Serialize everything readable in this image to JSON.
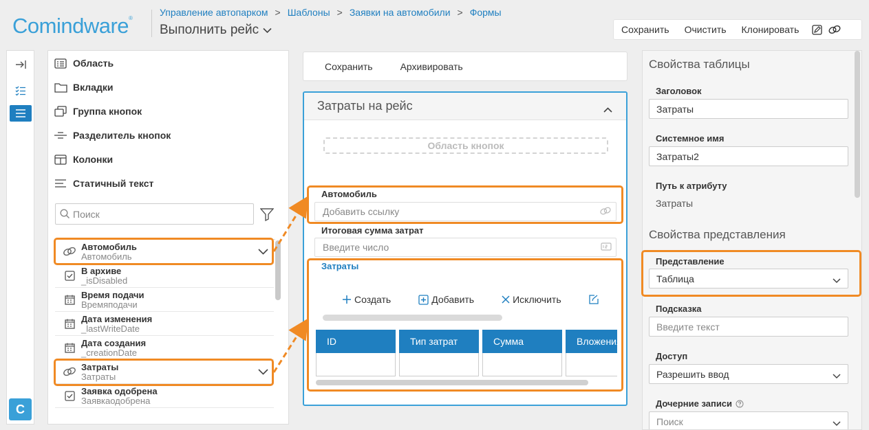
{
  "app": {
    "logo": "Comindware",
    "logo_mark": "®"
  },
  "header": {
    "breadcrumbs": [
      "Управление автопарком",
      "Шаблоны",
      "Заявки на автомобили",
      "Формы"
    ],
    "breadcrumb_sep": ">",
    "page_title": "Выполнить рейс"
  },
  "topbar": {
    "save": "Сохранить",
    "clear": "Очистить",
    "clone": "Клонировать"
  },
  "rail": {
    "c_label": "C"
  },
  "left": {
    "tools": [
      "Область",
      "Вкладки",
      "Группа кнопок",
      "Разделитель кнопок",
      "Колонки",
      "Статичный текст"
    ],
    "search_placeholder": "Поиск",
    "attributes": [
      {
        "name": "Автомобиль",
        "sys": "Автомобиль",
        "icon": "link-icon",
        "expand": true
      },
      {
        "name": "В архиве",
        "sys": "_isDisabled",
        "icon": "checkbox-icon",
        "expand": false
      },
      {
        "name": "Время подачи",
        "sys": "Времяподачи",
        "icon": "calendar-icon",
        "expand": false
      },
      {
        "name": "Дата изменения",
        "sys": "_lastWriteDate",
        "icon": "calendar-icon",
        "expand": false
      },
      {
        "name": "Дата создания",
        "sys": "_creationDate",
        "icon": "calendar-icon",
        "expand": false
      },
      {
        "name": "Затраты",
        "sys": "Затраты",
        "icon": "link-icon",
        "expand": true
      },
      {
        "name": "Заявка одобрена",
        "sys": "Заявкаодобрена",
        "icon": "checkbox-icon",
        "expand": false
      }
    ]
  },
  "middle": {
    "toolbar": {
      "save": "Сохранить",
      "archive": "Архивировать"
    },
    "panel_title": "Затраты на рейс",
    "button_area": "Область кнопок",
    "field_car_label": "Автомобиль",
    "field_car_placeholder": "Добавить ссылку",
    "field_sum_label": "Итоговая сумма затрат",
    "field_sum_placeholder": "Введите число",
    "table_label": "Затраты",
    "table_actions": [
      "Создать",
      "Добавить",
      "Исключить"
    ],
    "table_columns": [
      "ID",
      "Тип затрат",
      "Сумма",
      "Вложения"
    ]
  },
  "right": {
    "table_props_title": "Свойства таблицы",
    "header_label": "Заголовок",
    "header_value": "Затраты",
    "sysname_label": "Системное имя",
    "sysname_value": "Затраты2",
    "path_label": "Путь к атрибуту",
    "path_value": "Затраты",
    "view_props_title": "Свойства представления",
    "view_label": "Представление",
    "view_value": "Таблица",
    "hint_label": "Подсказка",
    "hint_placeholder": "Введите текст",
    "access_label": "Доступ",
    "access_value": "Разрешить ввод",
    "child_label": "Дочерние записи",
    "child_value": "Поиск"
  },
  "colors": {
    "accent": "#1f7fc0",
    "logo": "#3aa0d8",
    "highlight": "#f08a24"
  }
}
